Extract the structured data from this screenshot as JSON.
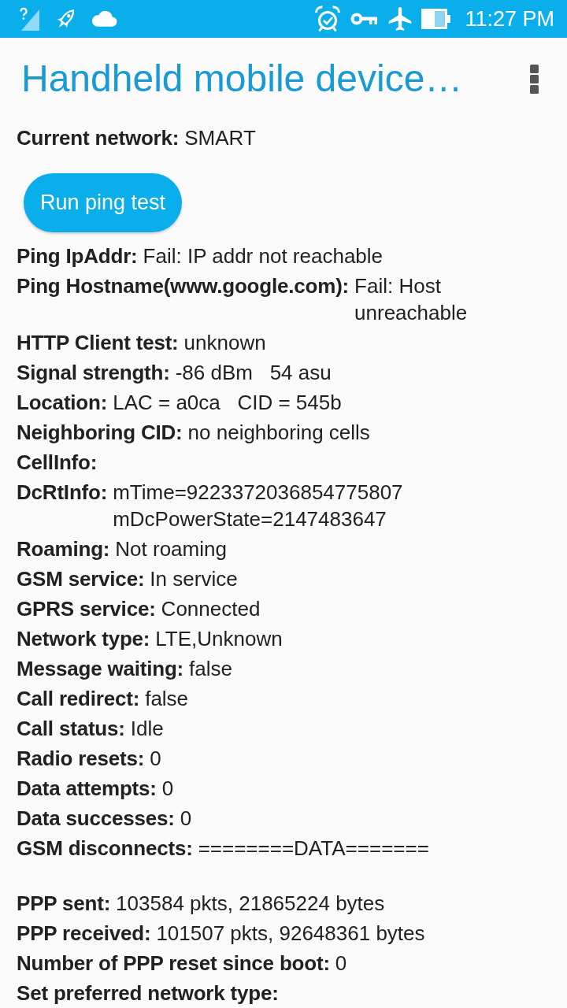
{
  "status_bar": {
    "time": "11:27 PM"
  },
  "app_bar": {
    "title": "Handheld mobile device…"
  },
  "current_network": {
    "label": "Current network:",
    "value": "SMART"
  },
  "ping_button": {
    "label": "Run ping test"
  },
  "details": [
    {
      "label": "Ping IpAddr:",
      "value": "Fail: IP addr not reachable"
    },
    {
      "label": "Ping Hostname(www.google.com):",
      "value": "Fail: Host unreachable"
    },
    {
      "label": "HTTP Client test:",
      "value": "unknown"
    },
    {
      "label": "Signal strength:",
      "value": "-86 dBm   54 asu"
    },
    {
      "label": "Location:",
      "value": "LAC = a0ca   CID = 545b"
    },
    {
      "label": "Neighboring CID:",
      "value": "no neighboring cells"
    },
    {
      "label": "CellInfo:"
    },
    {
      "label": "DcRtInfo:",
      "value": "mTime=9223372036854775807 mDcPowerState=2147483647"
    },
    {
      "label": "Roaming:",
      "value": "Not roaming"
    },
    {
      "label": "GSM service:",
      "value": "In service"
    },
    {
      "label": "GPRS service:",
      "value": "Connected"
    },
    {
      "label": "Network type:",
      "value": "LTE,Unknown"
    },
    {
      "label": "Message waiting:",
      "value": "false"
    },
    {
      "label": "Call redirect:",
      "value": "false"
    },
    {
      "label": "Call status:",
      "value": "Idle"
    },
    {
      "label": "Radio resets:",
      "value": "0"
    },
    {
      "label": "Data attempts:",
      "value": "0"
    },
    {
      "label": "Data successes:",
      "value": "0"
    },
    {
      "label": "GSM disconnects:",
      "value": "========DATA======="
    }
  ],
  "traffic": [
    {
      "label": "PPP sent:",
      "value": "103584 pkts, 21865224 bytes"
    },
    {
      "label": "PPP received:",
      "value": "101507 pkts, 92648361 bytes"
    },
    {
      "label": "Number of PPP reset since boot:",
      "value": "0"
    },
    {
      "label": "Set preferred network type:"
    }
  ]
}
